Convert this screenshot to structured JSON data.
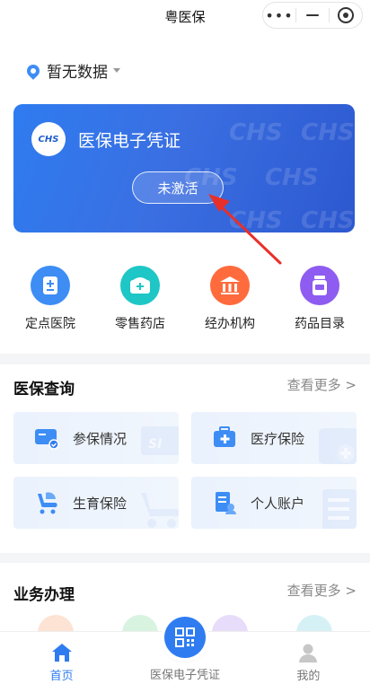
{
  "header": {
    "title": "粤医保"
  },
  "location": {
    "text": "暂无数据"
  },
  "card": {
    "logo_text": "CHS",
    "title": "医保电子凭证",
    "button_label": "未激活"
  },
  "quick_actions": [
    {
      "label": "定点医院",
      "icon": "hospital-icon",
      "color": "#3d8df5"
    },
    {
      "label": "零售药店",
      "icon": "pharmacy-icon",
      "color": "#1fc6c6"
    },
    {
      "label": "经办机构",
      "icon": "institution-icon",
      "color": "#ff6b3d"
    },
    {
      "label": "药品目录",
      "icon": "medicine-icon",
      "color": "#8e5cf0"
    }
  ],
  "query_section": {
    "title": "医保查询",
    "more": "查看更多 >",
    "tiles": [
      {
        "label": "参保情况",
        "icon": "insurance-card-icon"
      },
      {
        "label": "医疗保险",
        "icon": "medical-kit-icon"
      },
      {
        "label": "生育保险",
        "icon": "stroller-icon"
      },
      {
        "label": "个人账户",
        "icon": "account-document-icon"
      }
    ]
  },
  "business_section": {
    "title": "业务办理",
    "more": "查看更多 >"
  },
  "tabbar": {
    "home": "首页",
    "voucher": "医保电子凭证",
    "mine": "我的"
  },
  "colors": {
    "accent": "#2f7cf1",
    "card_start": "#2e7cf0",
    "card_end": "#2d58cf",
    "arrow": "#e8302a"
  }
}
